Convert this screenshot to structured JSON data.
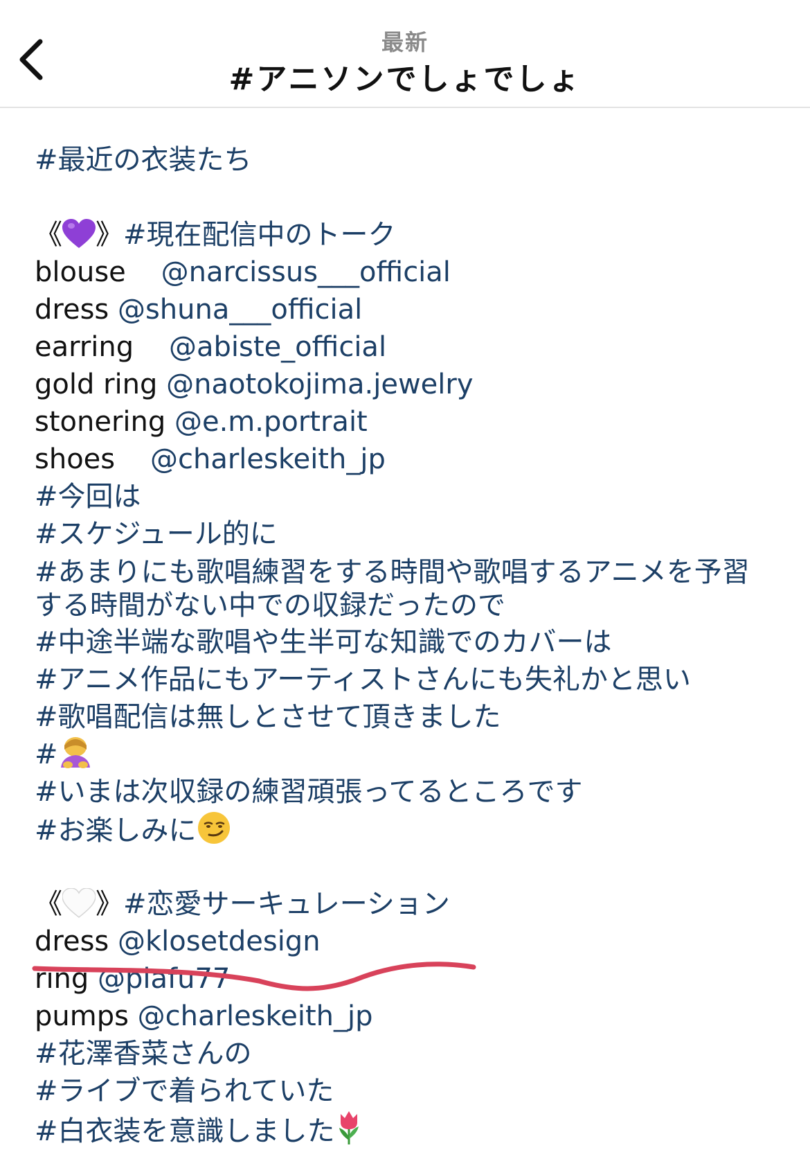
{
  "header": {
    "subtitle": "最新",
    "title": "#アニソンでしょでしょ"
  },
  "post": {
    "tag_recent_costumes": "#最近の衣装たち",
    "section1": {
      "bracket_open": "《",
      "bracket_close": "》",
      "heart_color": "#8e3fd6",
      "tag": "#現在配信中のトーク"
    },
    "credits1": [
      {
        "item": "blouse",
        "gap": "    ",
        "handle": "@narcissus___official"
      },
      {
        "item": "dress",
        "gap": " ",
        "handle": "@shuna___official"
      },
      {
        "item": "earring",
        "gap": "    ",
        "handle": "@abiste_official"
      },
      {
        "item": "gold ring",
        "gap": " ",
        "handle": "@naotokojima.jewelry"
      },
      {
        "item": "stonering",
        "gap": " ",
        "handle": "@e.m.portrait"
      },
      {
        "item": "shoes",
        "gap": "    ",
        "handle": "@charleskeith_jp"
      }
    ],
    "tags_block": [
      "#今回は",
      "#スケジュール的に",
      "#あまりにも歌唱練習をする時間や歌唱するアニメを予習する時間がない中での収録だったので",
      "#中途半端な歌唱や生半可な知識でのカバーは",
      "#アニメ作品にもアーティストさんにも失礼かと思い",
      "#歌唱配信は無しとさせて頂きました"
    ],
    "tag_bow": "#",
    "tag_practice": "#いまは次収録の練習頑張ってるところです",
    "tag_lookforward": "#お楽しみに",
    "section2": {
      "bracket_open": "《",
      "bracket_close": "》",
      "heart_color": "#ffffff",
      "tag": "#恋愛サーキュレーション"
    },
    "credits2": [
      {
        "item": "dress",
        "gap": " ",
        "handle": "@klosetdesign"
      },
      {
        "item": "ring",
        "gap": " ",
        "handle": "@plafu77"
      },
      {
        "item": "pumps",
        "gap": " ",
        "handle": "@charleskeith_jp"
      }
    ],
    "tags_end": [
      "#花澤香菜さんの",
      "#ライブで着られていた",
      "#白衣装を意識しました"
    ],
    "underline_color": "#d8425a"
  }
}
